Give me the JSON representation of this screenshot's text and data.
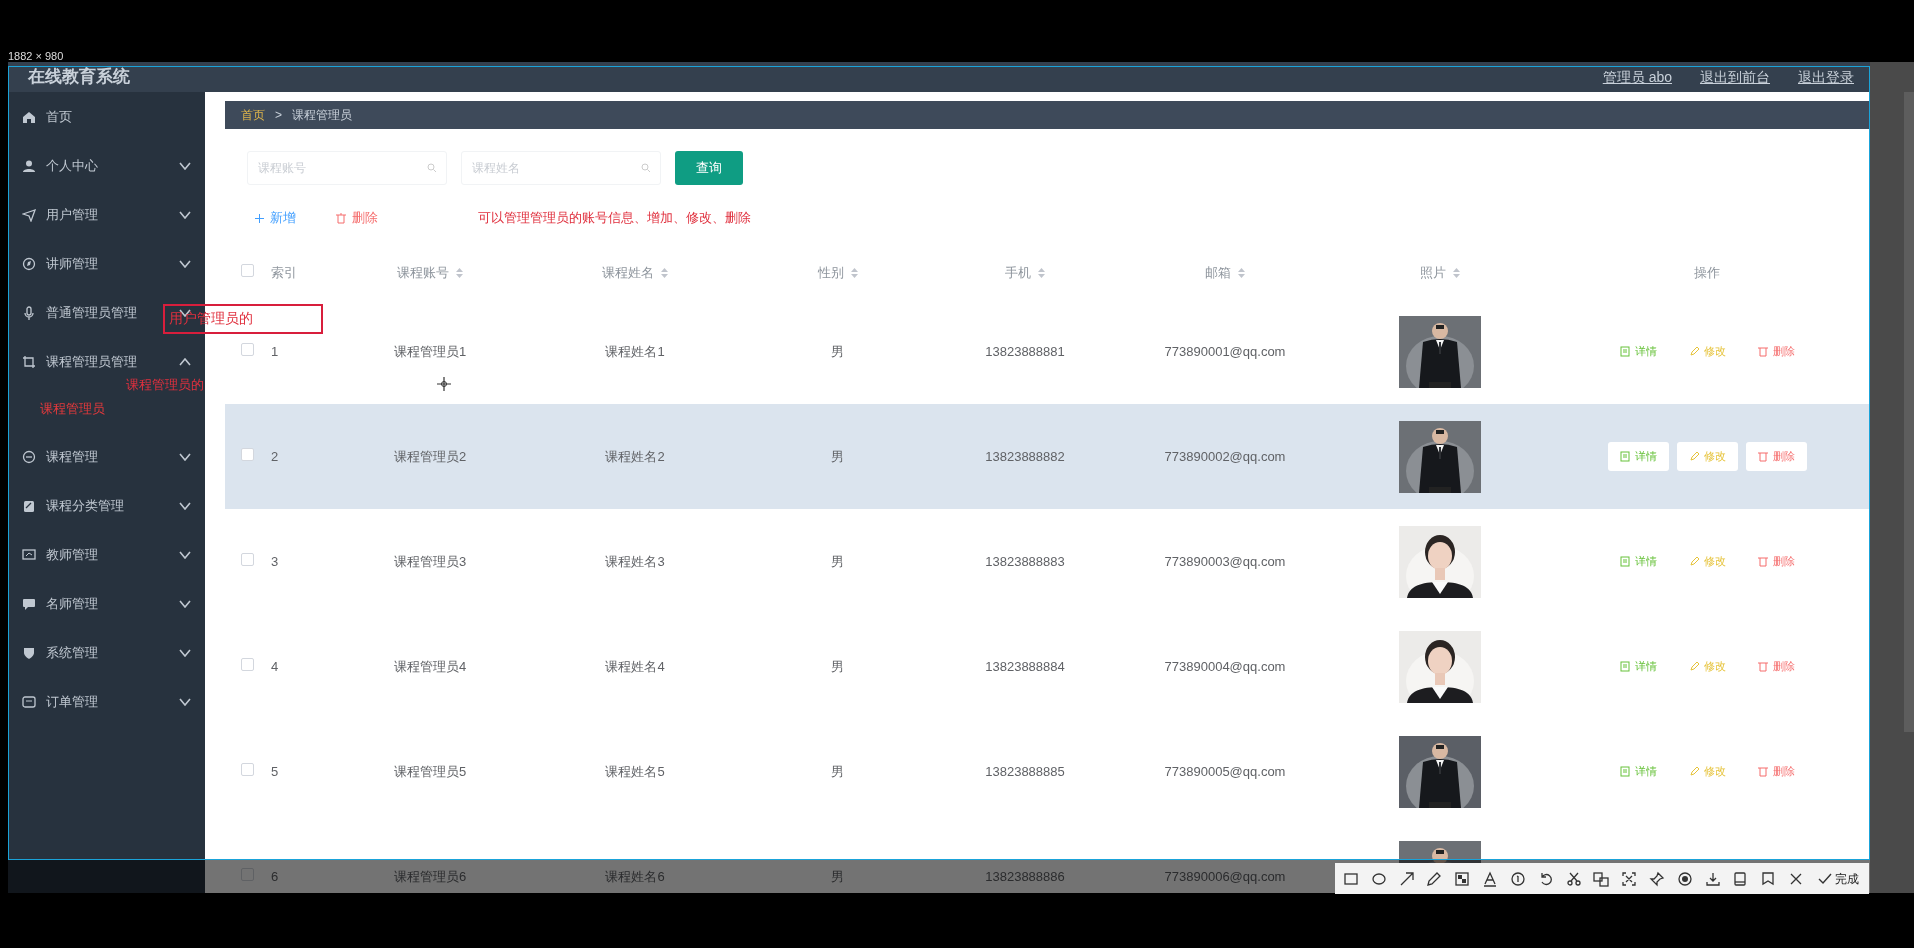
{
  "capture_size": "1882 × 980",
  "header": {
    "title": "在线教育系统",
    "links": [
      "管理员 abo",
      "退出到前台",
      "退出登录"
    ]
  },
  "sidebar": {
    "items": [
      {
        "label": "首页",
        "kind": "link"
      },
      {
        "label": "个人中心",
        "kind": "menu",
        "expanded": false
      },
      {
        "label": "用户管理",
        "kind": "menu",
        "expanded": false
      },
      {
        "label": "讲师管理",
        "kind": "menu",
        "expanded": false
      },
      {
        "label": "普通管理员管理",
        "kind": "menu",
        "expanded": false
      },
      {
        "label": "课程管理员管理",
        "kind": "menu",
        "expanded": true,
        "children": [
          {
            "label": "课程管理员",
            "selected": true
          }
        ]
      },
      {
        "label": "课程管理",
        "kind": "menu",
        "expanded": false
      },
      {
        "label": "课程分类管理",
        "kind": "menu",
        "expanded": false
      },
      {
        "label": "教师管理",
        "kind": "menu",
        "expanded": false
      },
      {
        "label": "名师管理",
        "kind": "menu",
        "expanded": false
      },
      {
        "label": "系统管理",
        "kind": "menu",
        "expanded": false
      },
      {
        "label": "订单管理",
        "kind": "menu",
        "expanded": false
      }
    ]
  },
  "breadcrumb": [
    "首页",
    ">",
    "课程管理员"
  ],
  "search": {
    "fields": [
      {
        "placeholder": "课程账号"
      },
      {
        "placeholder": "课程姓名"
      }
    ],
    "button": "查询"
  },
  "actions": [
    {
      "label": "新增",
      "kind": "add"
    },
    {
      "label": "删除",
      "kind": "delete"
    }
  ],
  "table": {
    "all_checked": false,
    "columns": [
      {
        "label": "索引",
        "sortable": false
      },
      {
        "label": "课程账号",
        "sortable": true
      },
      {
        "label": "课程姓名",
        "sortable": true
      },
      {
        "label": "性别",
        "sortable": true
      },
      {
        "label": "手机",
        "sortable": true
      },
      {
        "label": "邮箱",
        "sortable": true
      },
      {
        "label": "照片",
        "sortable": true
      },
      {
        "label": "操作",
        "sortable": false
      }
    ],
    "rows": [
      {
        "index": "1",
        "account": "课程管理员1",
        "name": "课程姓名1",
        "gender": "男",
        "phone": "13823888881",
        "email": "773890001@qq.com",
        "checked": false,
        "hovered": false,
        "actions": [
          {
            "label": "详情",
            "kind": "detail"
          },
          {
            "label": "修改",
            "kind": "edit"
          },
          {
            "label": "删除",
            "kind": "delete"
          }
        ]
      },
      {
        "index": "2",
        "account": "课程管理员2",
        "name": "课程姓名2",
        "gender": "男",
        "phone": "13823888882",
        "email": "773890002@qq.com",
        "checked": false,
        "hovered": true,
        "actions": [
          {
            "label": "详情",
            "kind": "detail"
          },
          {
            "label": "修改",
            "kind": "edit"
          },
          {
            "label": "删除",
            "kind": "delete"
          }
        ]
      },
      {
        "index": "3",
        "account": "课程管理员3",
        "name": "课程姓名3",
        "gender": "男",
        "phone": "13823888883",
        "email": "773890003@qq.com",
        "checked": false,
        "hovered": false,
        "actions": [
          {
            "label": "详情",
            "kind": "detail"
          },
          {
            "label": "修改",
            "kind": "edit"
          },
          {
            "label": "删除",
            "kind": "delete"
          }
        ]
      },
      {
        "index": "4",
        "account": "课程管理员4",
        "name": "课程姓名4",
        "gender": "男",
        "phone": "13823888884",
        "email": "773890004@qq.com",
        "checked": false,
        "hovered": false,
        "actions": [
          {
            "label": "详情",
            "kind": "detail"
          },
          {
            "label": "修改",
            "kind": "edit"
          },
          {
            "label": "删除",
            "kind": "delete"
          }
        ]
      },
      {
        "index": "5",
        "account": "课程管理员5",
        "name": "课程姓名5",
        "gender": "男",
        "phone": "13823888885",
        "email": "773890005@qq.com",
        "checked": false,
        "hovered": false,
        "actions": [
          {
            "label": "详情",
            "kind": "detail"
          },
          {
            "label": "修改",
            "kind": "edit"
          },
          {
            "label": "删除",
            "kind": "delete"
          }
        ]
      },
      {
        "index": "6",
        "account": "课程管理员6",
        "name": "课程姓名6",
        "gender": "男",
        "phone": "13823888886",
        "email": "773890006@qq.com",
        "checked": false
      }
    ]
  },
  "annotations": [
    {
      "kind": "boxed",
      "text": "用户管理员的"
    },
    {
      "kind": "plain",
      "text": "课程管理员的"
    },
    {
      "kind": "note",
      "text": "可以管理管理员的账号信息、增加、修改、删除"
    }
  ],
  "capture_toolbar": {
    "confirm": "完成"
  }
}
